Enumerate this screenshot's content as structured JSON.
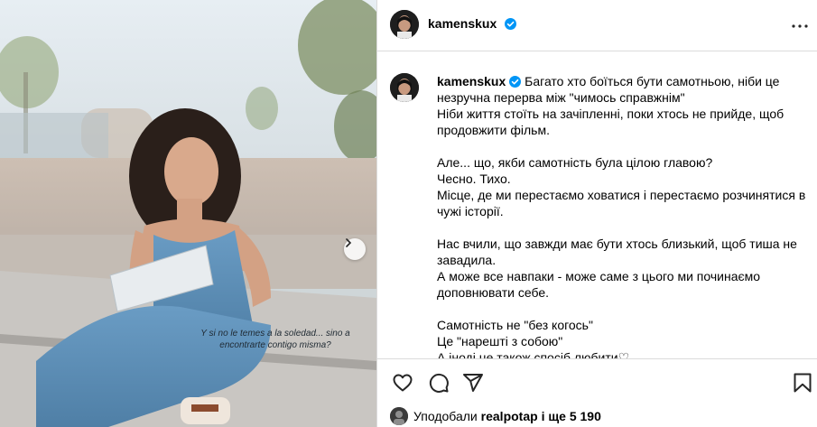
{
  "post": {
    "photo_overlay_text": "Y si no le temes a la soledad... sino a encontrarte contigo misma?",
    "image_alt": "woman in denim jumpsuit sitting with notebook"
  },
  "header": {
    "username": "kamenskux",
    "verified_icon": "verified-badge-icon",
    "more_icon": "more-options-icon"
  },
  "caption": {
    "username": "kamenskux",
    "text": "Багато хто боїться бути самотньою, ніби це незручна перерва між \"чимось справжнім\"\nНіби життя стоїть на зачіпленні, поки хтось не прийде, щоб продовжити фільм.\n\nАле... що, якби самотність була цілою главою?\nЧесно. Тихо.\nМісце, де ми перестаємо ховатися і перестаємо розчинятися в чужі історії.\n\nНас вчили, що завжди має бути хтось близький, щоб тиша не завадила.\nА може все навпаки - може саме з цього ми починаємо доповнювати себе.\n\nСамотність не \"без когось\"\nЦе \"нарешті з собою\"\nА іноді це також спосіб любити♡"
  },
  "actions": {
    "like_icon": "heart-icon",
    "comment_icon": "comment-icon",
    "share_icon": "share-icon",
    "save_icon": "bookmark-icon"
  },
  "likes": {
    "prefix": "Уподобали",
    "user": "realpotap",
    "suffix": "і ще 5 190"
  },
  "colors": {
    "verified": "#0095f6",
    "divider": "#dbdbdb",
    "denim": "#5b8fb8"
  }
}
